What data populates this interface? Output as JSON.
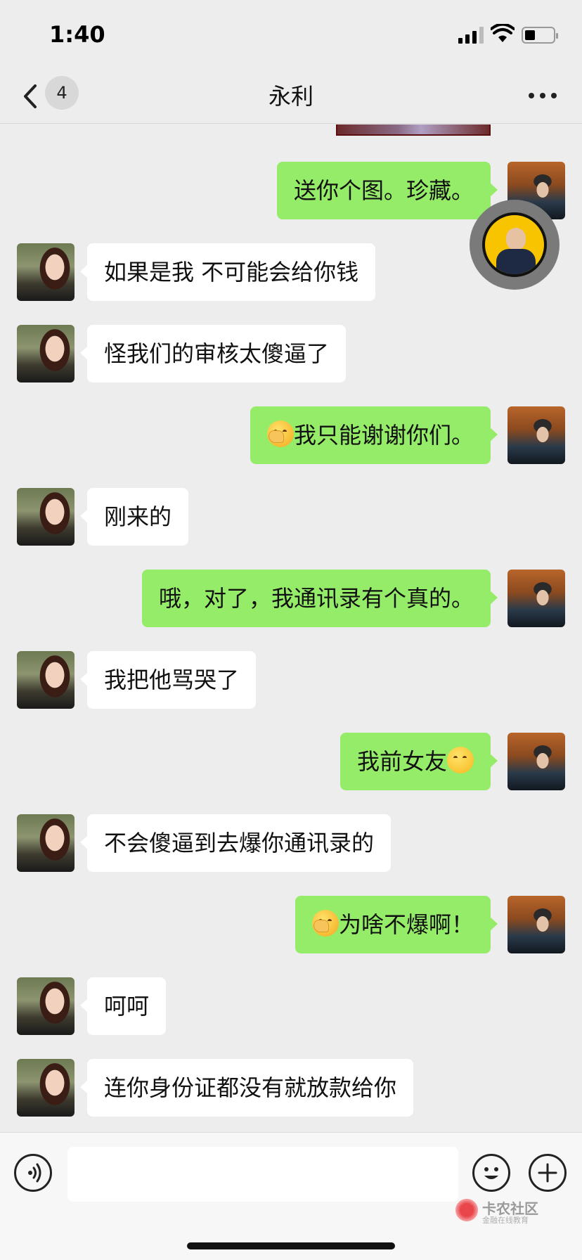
{
  "status_bar": {
    "time": "1:40"
  },
  "nav": {
    "title": "永利",
    "unread_count": "4"
  },
  "messages": [
    {
      "side": "out",
      "text": "送你个图。珍藏。"
    },
    {
      "side": "in",
      "text": "如果是我 不可能会给你钱"
    },
    {
      "side": "in",
      "text": "怪我们的审核太傻逼了"
    },
    {
      "side": "out",
      "emoji": "facepalm-emoji",
      "text": "我只能谢谢你们。"
    },
    {
      "side": "in",
      "text": "刚来的"
    },
    {
      "side": "out",
      "text": "哦，对了，我通讯录有个真的。"
    },
    {
      "side": "in",
      "text": "我把他骂哭了"
    },
    {
      "side": "out",
      "text": "我前女友",
      "emoji_after": "smirk-emoji"
    },
    {
      "side": "in",
      "text": "不会傻逼到去爆你通讯录的"
    },
    {
      "side": "out",
      "emoji": "facepalm-emoji",
      "text": "为啥不爆啊！"
    },
    {
      "side": "in",
      "text": "呵呵"
    },
    {
      "side": "in",
      "text": "连你身份证都没有就放款给你"
    }
  ],
  "watermark": {
    "title": "卡农社区",
    "subtitle": "金融在线教育"
  },
  "colors": {
    "outgoing_bubble": "#95ec69",
    "incoming_bubble": "#ffffff",
    "background": "#ededed"
  }
}
